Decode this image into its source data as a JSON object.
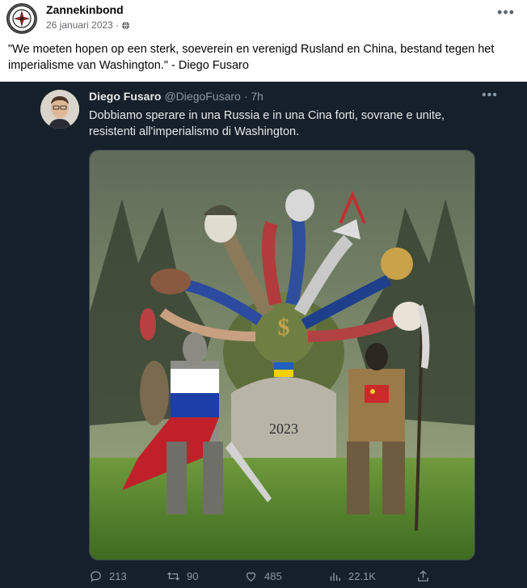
{
  "post": {
    "author": "Zannekinbond",
    "date": "26 januari 2023",
    "separator": "·",
    "more_icon": "more-horizontal-icon",
    "text": "\"We moeten hopen op een sterk, soeverein en verenigd Rusland en China, bestand tegen het imperialisme van Washington.\" - Diego Fusaro"
  },
  "tweet": {
    "name": "Diego Fusaro",
    "handle": "@DiegoFusaro",
    "time": "· 7h",
    "text": "Dobbiamo sperare in una Russia e in una Cina forti, sovrane e unite, resistenti all'imperialismo di Washington.",
    "artwork_label": "2023",
    "actions": {
      "replies": "213",
      "retweets": "90",
      "likes": "485",
      "views": "22.1K"
    }
  },
  "colors": {
    "tweet_bg": "#15202b",
    "tweet_text": "#e7e9ea",
    "tweet_muted": "#8b98a5",
    "fb_muted": "#65676b"
  }
}
